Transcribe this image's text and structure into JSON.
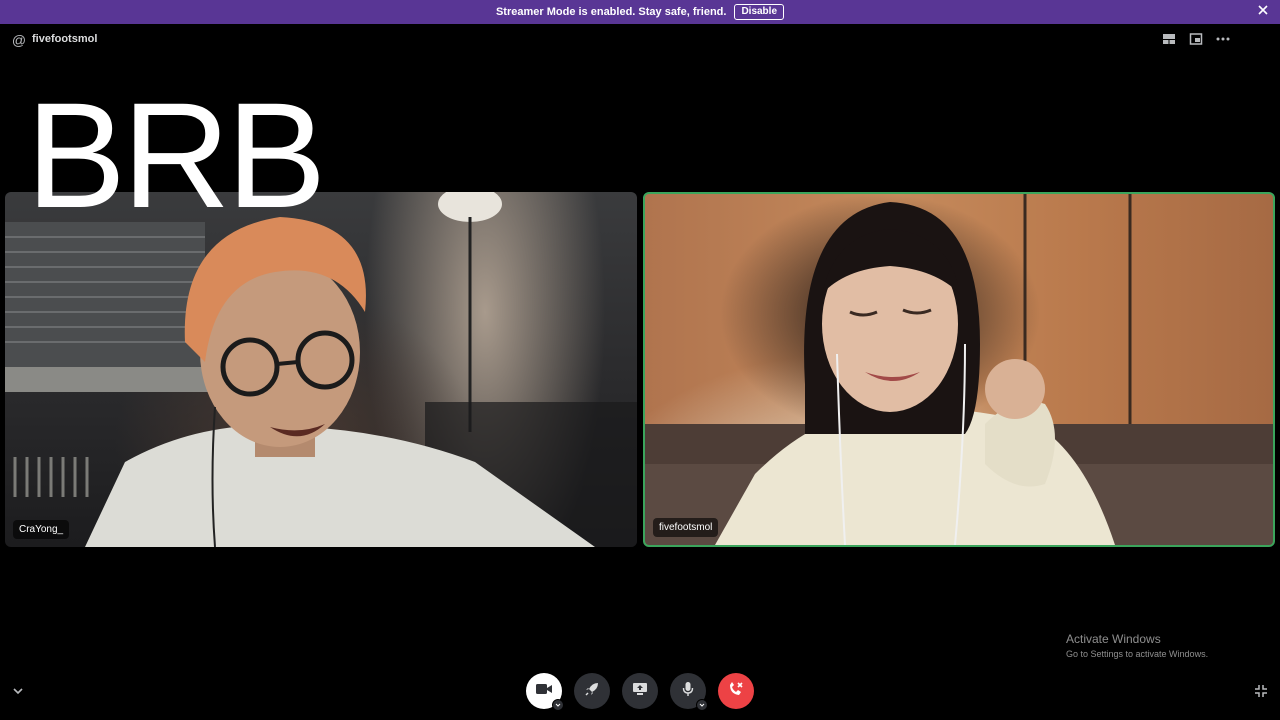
{
  "banner": {
    "message": "Streamer Mode is enabled. Stay safe, friend.",
    "disable_label": "Disable",
    "close_icon": "close-icon",
    "color": "#593695"
  },
  "header": {
    "channel_icon": "at-icon",
    "channel_name": "fivefootsmol",
    "icons": [
      "grid-layout-icon",
      "popout-icon",
      "more-icon"
    ]
  },
  "overlay": {
    "text": "BRB"
  },
  "tiles": [
    {
      "name": "CraYong_",
      "speaking": false
    },
    {
      "name": "fivefootsmol",
      "speaking": true,
      "speaking_color": "#3ba55c"
    }
  ],
  "controls": [
    {
      "name": "camera",
      "icon": "camera-icon",
      "active": true
    },
    {
      "name": "activity",
      "icon": "rocket-icon"
    },
    {
      "name": "screen-share",
      "icon": "screen-share-icon"
    },
    {
      "name": "microphone",
      "icon": "microphone-icon"
    },
    {
      "name": "disconnect",
      "icon": "hang-up-icon",
      "color": "#ed4245"
    }
  ],
  "watermark": {
    "title": "Activate Windows",
    "subtitle": "Go to Settings to activate Windows."
  }
}
